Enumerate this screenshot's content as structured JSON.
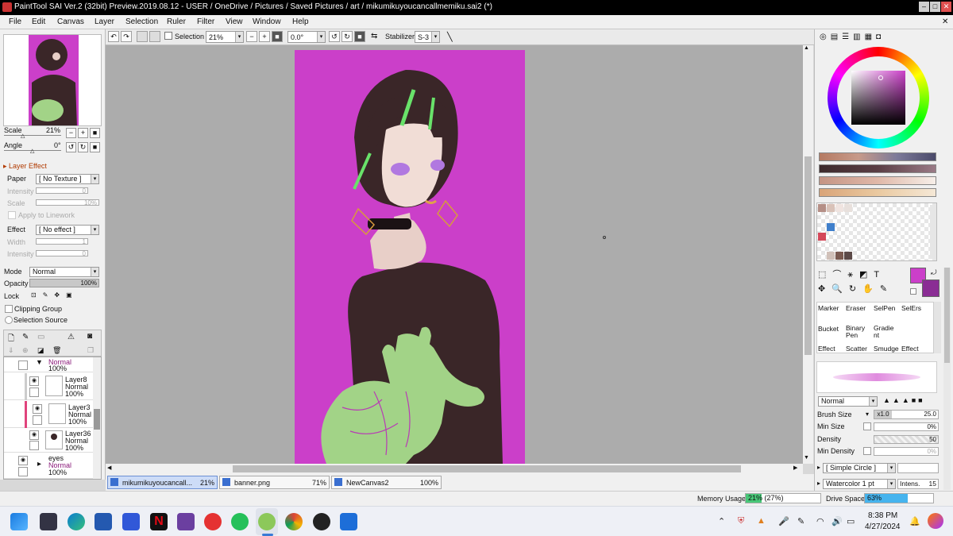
{
  "window": {
    "title": "PaintTool SAI Ver.2 (32bit) Preview.2019.08.12 - USER / OneDrive / Pictures / Saved Pictures / art / mikumikuyoucancallmemiku.sai2 (*)"
  },
  "menu": [
    "File",
    "Edit",
    "Canvas",
    "Layer",
    "Selection",
    "Ruler",
    "Filter",
    "View",
    "Window",
    "Help"
  ],
  "toolbar": {
    "selection_label": "Selection",
    "zoom": "21%",
    "rotation": "0.0°",
    "stabilizer_label": "Stabilizer",
    "stabilizer_value": "S-3"
  },
  "navigator": {
    "scale_label": "Scale",
    "scale_value": "21%",
    "angle_label": "Angle",
    "angle_value": "0°"
  },
  "layer_effect": {
    "header": "Layer Effect",
    "paper_label": "Paper",
    "paper_value": "[ No Texture ]",
    "intensity_label": "Intensity",
    "intensity_value": "0",
    "scale_label": "Scale",
    "scale_value": "10%",
    "apply_label": "Apply to Linework",
    "effect_label": "Effect",
    "effect_value": "[ No effect ]",
    "width_label": "Width",
    "width_value": "1",
    "intensity2_label": "Intensity",
    "intensity2_value": "0"
  },
  "layer_props": {
    "mode_label": "Mode",
    "mode_value": "Normal",
    "opacity_label": "Opacity",
    "opacity_value": "100%",
    "lock_label": "Lock",
    "clipping_label": "Clipping Group",
    "selection_source_label": "Selection Source"
  },
  "layers": [
    {
      "name": "",
      "mode": "Normal",
      "opacity": "100%",
      "type": "folder"
    },
    {
      "name": "Layer8",
      "mode": "Normal",
      "opacity": "100%"
    },
    {
      "name": "Layer3",
      "mode": "Normal",
      "opacity": "100%"
    },
    {
      "name": "Layer36",
      "mode": "Normal",
      "opacity": "100%"
    },
    {
      "name": "eyes",
      "mode": "Normal",
      "opacity": "100%",
      "type": "folder"
    }
  ],
  "doc_tabs": [
    {
      "name": "mikumikuyoucancall...",
      "zoom": "21%"
    },
    {
      "name": "banner.png",
      "zoom": "71%"
    },
    {
      "name": "NewCanvas2",
      "zoom": "100%"
    }
  ],
  "colors": {
    "canvas_bg": "#cb3fc9",
    "main_color": "#cb3fc9",
    "sub_color": "#8a2d94",
    "swatches": [
      "#b58f86",
      "#d9c2b8",
      "#f0e4e0",
      "#e8e0dc",
      "#3f7fcb",
      "#d4485a",
      "#7a5a50",
      "#b49a90",
      "#5c4a48",
      "#6d5c58"
    ]
  },
  "tools": [
    "Marker",
    "Eraser",
    "SelPen",
    "SelErs",
    "Bucket",
    "Binary Pen",
    "Gradient",
    "Effect",
    "Scatter",
    "Smudge",
    "Effect"
  ],
  "brush": {
    "blend_mode": "Normal",
    "size_label": "Brush Size",
    "size_mult": "x1.0",
    "size_value": "25.0",
    "min_size_label": "Min Size",
    "min_size_value": "0%",
    "density_label": "Density",
    "density_value": "50",
    "min_density_label": "Min Density",
    "min_density_value": "0%",
    "shape": "[ Simple Circle ]",
    "texture": "Watercolor 1 pt",
    "intens_label": "Intens.",
    "intens_value": "15"
  },
  "status": {
    "memory_label": "Memory Usage",
    "memory_value": "21% (27%)",
    "drive_label": "Drive Space",
    "drive_value": "63%"
  },
  "clock": {
    "time": "8:38 PM",
    "date": "4/27/2024"
  }
}
